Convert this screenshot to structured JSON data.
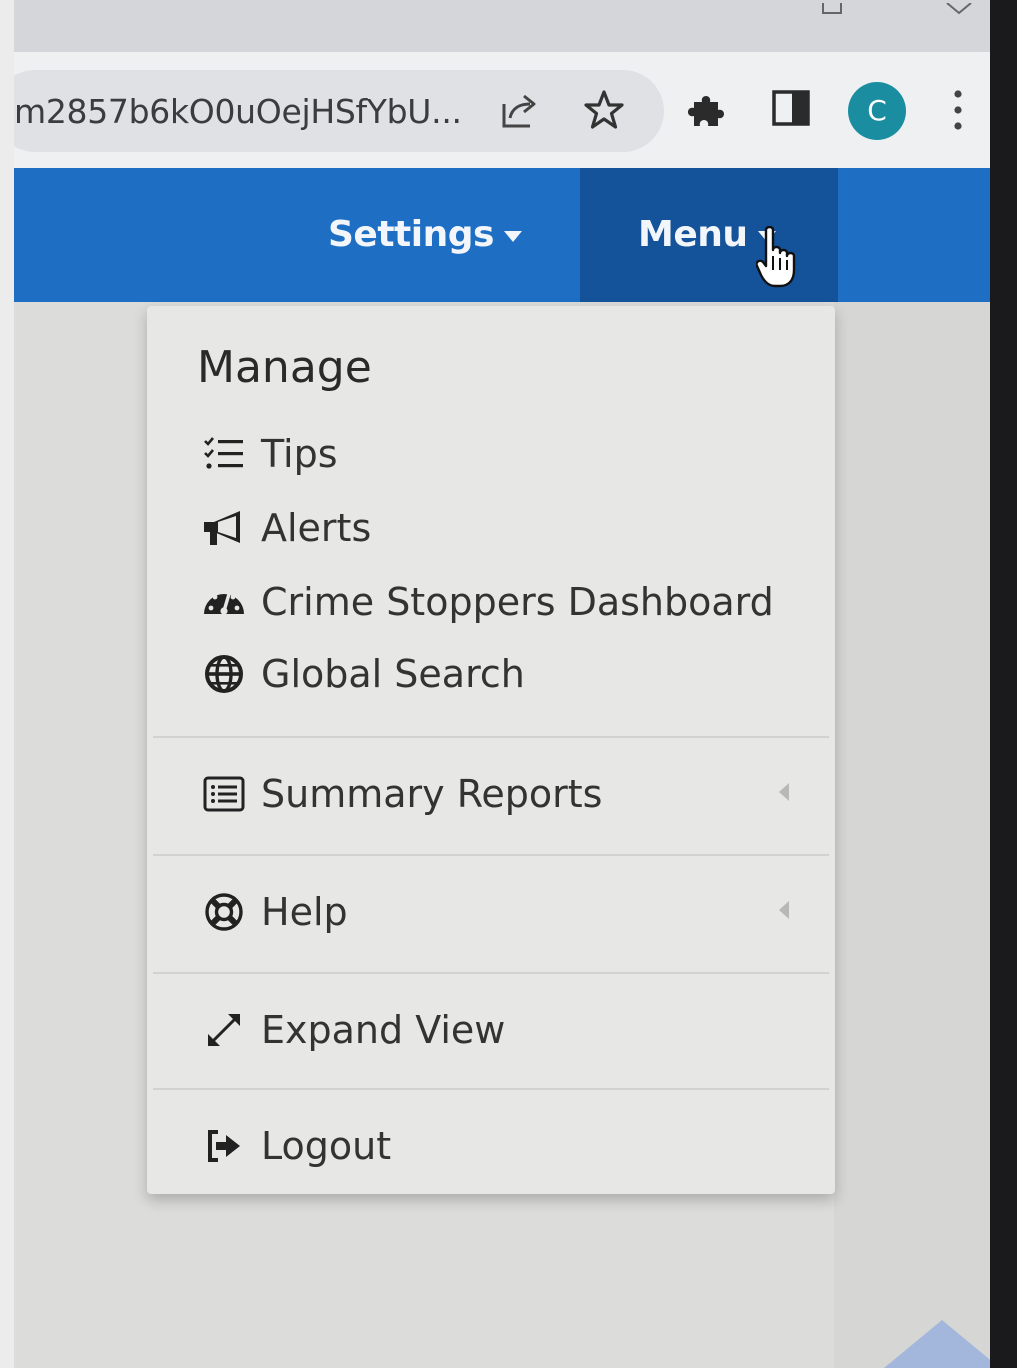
{
  "browser": {
    "url": "m2857b6kO0uOejHSfYbU...",
    "avatar_letter": "C",
    "icons": [
      "share-icon",
      "bookmark-star-icon",
      "extensions-icon",
      "side-panel-icon",
      "kebab-menu-icon"
    ]
  },
  "navbar": {
    "settings_label": "Settings",
    "menu_label": "Menu",
    "color": "#1e6fc4",
    "active_color": "#14539a"
  },
  "dropdown": {
    "header": "Manage",
    "items": [
      {
        "label": "Tips",
        "icon": "tasks-list-icon"
      },
      {
        "label": "Alerts",
        "icon": "megaphone-icon"
      },
      {
        "label": "Crime Stoppers Dashboard",
        "icon": "dashboard-gauge-icon"
      },
      {
        "label": "Global Search",
        "icon": "globe-icon"
      },
      {
        "label": "Summary Reports",
        "icon": "list-alt-icon",
        "submenu": true
      },
      {
        "label": "Help",
        "icon": "life-ring-icon",
        "submenu": true
      },
      {
        "label": "Expand View",
        "icon": "expand-arrows-icon"
      },
      {
        "label": "Logout",
        "icon": "sign-out-icon"
      }
    ]
  }
}
